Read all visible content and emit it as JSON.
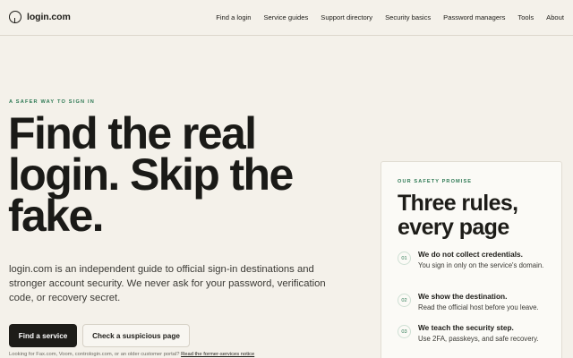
{
  "header": {
    "logo_text": "login.com",
    "nav": [
      {
        "label": "Find a login"
      },
      {
        "label": "Service guides"
      },
      {
        "label": "Support directory"
      },
      {
        "label": "Security basics"
      },
      {
        "label": "Password managers"
      },
      {
        "label": "Tools"
      },
      {
        "label": "About"
      }
    ]
  },
  "hero": {
    "eyebrow": "A SAFER WAY TO SIGN IN",
    "title": "Find the real login. Skip the fake.",
    "lead": "login.com is an independent guide to official sign-in destinations and stronger account security. We never ask for your password, verification code, or recovery secret.",
    "primary_button": "Find a service",
    "secondary_button": "Check a suspicious page",
    "footnote_text": "Looking for Fax.com, Voom, contrologin.com, or an older customer portal?",
    "footnote_link": "Read the former-services notice"
  },
  "card": {
    "eyebrow": "OUR SAFETY PROMISE",
    "title": "Three rules, every page",
    "rules": [
      {
        "num": "01",
        "title": "We do not collect credentials.",
        "desc": "You sign in only on the service's domain."
      },
      {
        "num": "02",
        "title": "We show the destination.",
        "desc": "Read the official host before you leave."
      },
      {
        "num": "03",
        "title": "We teach the security step.",
        "desc": "Use 2FA, passkeys, and safe recovery."
      }
    ]
  },
  "colors": {
    "background": "#f4f1ea",
    "accent_green": "#2f7a55",
    "ink": "#1d1c18"
  }
}
